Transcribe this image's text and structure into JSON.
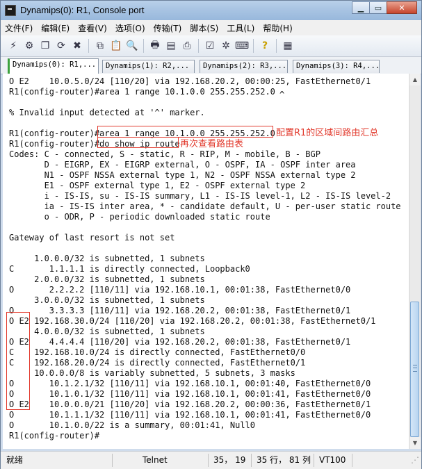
{
  "window": {
    "title": "Dynamips(0): R1, Console port"
  },
  "menubar": {
    "items": [
      "文件(F)",
      "编辑(E)",
      "查看(V)",
      "选项(O)",
      "传输(T)",
      "脚本(S)",
      "工具(L)",
      "帮助(H)"
    ]
  },
  "toolbar": {
    "icons": [
      "connect-icon",
      "quick-connect-icon",
      "connect-in-tab-icon",
      "reconnect-icon",
      "disconnect-icon",
      "copy-icon",
      "paste-icon",
      "find-icon",
      "print-icon",
      "print-setup-icon",
      "printer-icon",
      "session-options-icon",
      "global-options-icon",
      "keymap-icon",
      "help-icon",
      "sftp-icon"
    ]
  },
  "tabs": [
    {
      "label": "Dynamips(0): R1,..."
    },
    {
      "label": "Dynamips(1): R2,..."
    },
    {
      "label": "Dynamips(2): R3,..."
    },
    {
      "label": "Dynamips(3): R4,..."
    }
  ],
  "console": {
    "lines": [
      "O E2    10.0.5.0/24 [110/20] via 192.168.20.2, 00:00:25, FastEthernet0/1",
      "R1(config-router)#area 1 range 10.1.0.0 255.255.252.0",
      "",
      "% Invalid input detected at '^' marker.",
      "",
      "R1(config-router)#area 1 range 10.1.0.0 255.255.252.0",
      "R1(config-router)#do show ip route",
      "Codes: C - connected, S - static, R - RIP, M - mobile, B - BGP",
      "       D - EIGRP, EX - EIGRP external, O - OSPF, IA - OSPF inter area",
      "       N1 - OSPF NSSA external type 1, N2 - OSPF NSSA external type 2",
      "       E1 - OSPF external type 1, E2 - OSPF external type 2",
      "       i - IS-IS, su - IS-IS summary, L1 - IS-IS level-1, L2 - IS-IS level-2",
      "       ia - IS-IS inter area, * - candidate default, U - per-user static route",
      "       o - ODR, P - periodic downloaded static route",
      "",
      "Gateway of last resort is not set",
      "",
      "     1.0.0.0/32 is subnetted, 1 subnets",
      "C       1.1.1.1 is directly connected, Loopback0",
      "     2.0.0.0/32 is subnetted, 1 subnets",
      "O       2.2.2.2 [110/11] via 192.168.10.1, 00:01:38, FastEthernet0/0",
      "     3.0.0.0/32 is subnetted, 1 subnets",
      "O       3.3.3.3 [110/11] via 192.168.20.2, 00:01:38, FastEthernet0/1",
      "O E2 192.168.30.0/24 [110/20] via 192.168.20.2, 00:01:38, FastEthernet0/1",
      "     4.0.0.0/32 is subnetted, 1 subnets",
      "O E2    4.4.4.4 [110/20] via 192.168.20.2, 00:01:38, FastEthernet0/1",
      "C    192.168.10.0/24 is directly connected, FastEthernet0/0",
      "C    192.168.20.0/24 is directly connected, FastEthernet0/1",
      "     10.0.0.0/8 is variably subnetted, 5 subnets, 3 masks",
      "O       10.1.2.1/32 [110/11] via 192.168.10.1, 00:01:40, FastEthernet0/0",
      "O       10.1.0.1/32 [110/11] via 192.168.10.1, 00:01:41, FastEthernet0/0",
      "O E2    10.0.0.0/21 [110/20] via 192.168.20.2, 00:00:36, FastEthernet0/1",
      "O       10.1.1.1/32 [110/11] via 192.168.10.1, 00:01:41, FastEthernet0/0",
      "O       10.1.0.0/22 is a summary, 00:01:41, Null0",
      "R1(config-router)#"
    ],
    "caret": "^"
  },
  "annotations": {
    "note1": "配置R1的区域间路由汇总",
    "note2": "再次查看路由表"
  },
  "statusbar": {
    "status": "就绪",
    "protocol": "Telnet",
    "cursor": "35， 19",
    "position": "35 行， 81 列",
    "emulation": "VT100"
  },
  "colors": {
    "annotation": "#e23b2e",
    "active_tab_marker": "#3da23d"
  }
}
